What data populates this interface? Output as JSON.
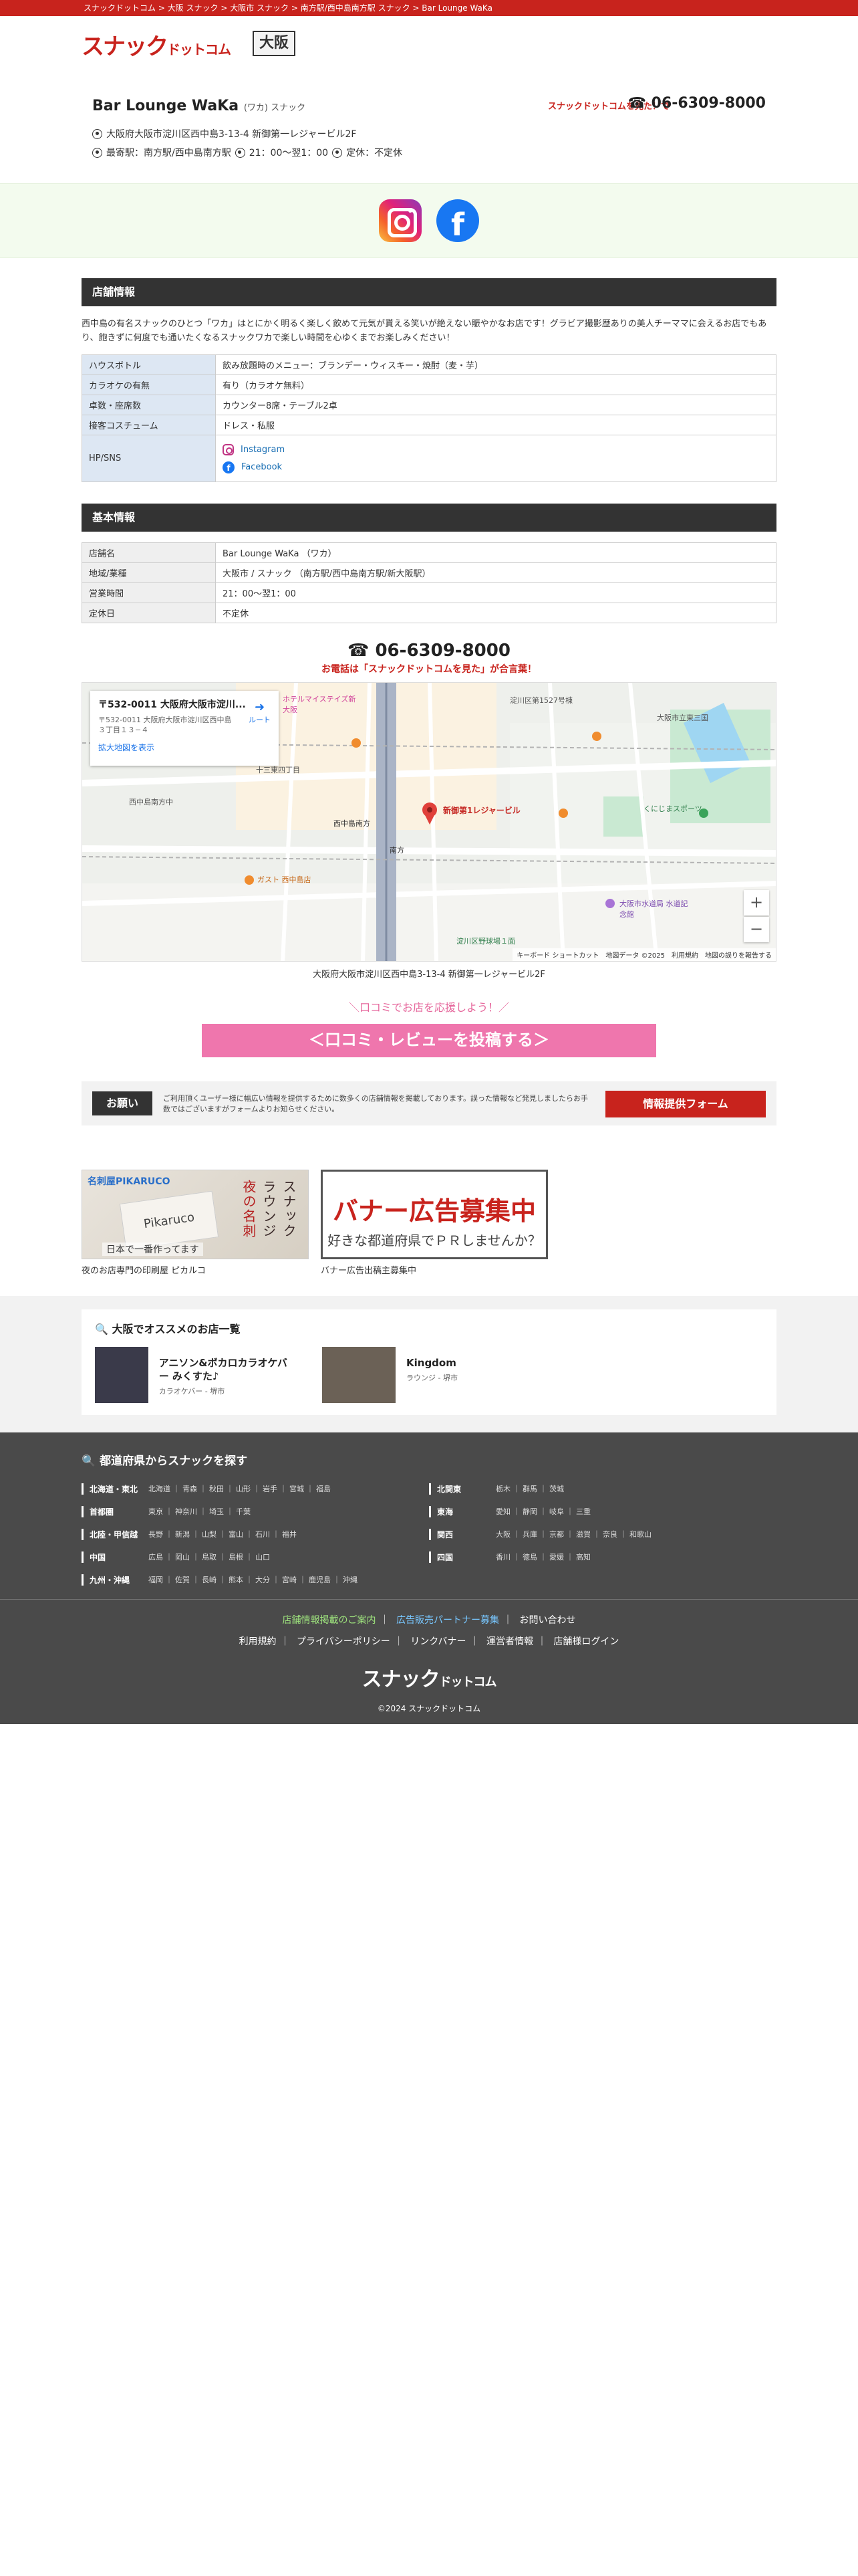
{
  "breadcrumb": [
    "スナックドットコム",
    "大阪 スナック",
    "大阪市 スナック",
    "南方駅/西中島南方駅 スナック",
    "Bar Lounge WaKa"
  ],
  "logo": {
    "main": "スナック",
    "sub": "ドットコム"
  },
  "prefecture": "大阪",
  "shop": {
    "name": "Bar Lounge WaKa",
    "kana": "(ワカ) スナック",
    "see_text": "スナックドットコムを見た！で",
    "tel": "06-6309-8000",
    "address": "大阪府大阪市淀川区西中島3-13-4 新御第一レジャービル2F",
    "station": "最寄駅：南方駅/西中島南方駅",
    "hours": "21：00〜翌1：00",
    "holiday": "定休：不定休"
  },
  "shop_info": {
    "title": "店舗情報",
    "description": "西中島の有名スナックのひとつ「ワカ」はとにかく明るく楽しく飲めて元気が貰える笑いが絶えない賑やかなお店です！グラビア撮影歴ありの美人チーママに会えるお店でもあり、飽きずに何度でも通いたくなるスナックワカで楽しい時間を心ゆくまでお楽しみください！",
    "rows": [
      {
        "k": "ハウスボトル",
        "v": "飲み放題時のメニュー：ブランデー・ウィスキー・焼酎（麦・芋）"
      },
      {
        "k": "カラオケの有無",
        "v": "有り（カラオケ無料）"
      },
      {
        "k": "卓数・座席数",
        "v": "カウンター8席・テーブル2卓"
      },
      {
        "k": "接客コスチューム",
        "v": "ドレス・私服"
      }
    ],
    "sns_key": "HP/SNS",
    "instagram": "Instagram",
    "facebook": "Facebook"
  },
  "basic_info": {
    "title": "基本情報",
    "rows": [
      {
        "k": "店舗名",
        "v": "Bar Lounge WaKa （ワカ）"
      },
      {
        "k": "地域/業種",
        "v": "大阪市 / スナック （南方駅/西中島南方駅/新大阪駅）"
      },
      {
        "k": "営業時間",
        "v": "21：00〜翌1：00"
      },
      {
        "k": "定休日",
        "v": "不定休"
      }
    ]
  },
  "tel_block": {
    "tel": "06-6309-8000",
    "note": "お電話は「スナックドットコムを見た」が合言葉！"
  },
  "map": {
    "card_title": "〒532-0011 大阪府大阪市淀川...",
    "card_sub": "〒532-0011 大阪府大阪市淀川区西中島３丁目１３−４",
    "enlarge": "拡大地図を表示",
    "route": "ルート",
    "pin_label": "新御第1レジャービル",
    "labels": [
      "淀川区第1527号棟",
      "大阪市立東三国",
      "西中島南方",
      "南方",
      "十三東四丁目",
      "西中島南方中",
      "ホテルマイステイズ新大阪",
      "ガスト 西中島店",
      "大阪市水道局 水道記念館",
      "淀川区野球場１面",
      "くにじまスポーツ"
    ],
    "footer": "キーボード ショートカット　地図データ ©2025　利用規約　地図の誤りを報告する",
    "address": "大阪府大阪市淀川区西中島3-13-4 新御第一レジャービル2F"
  },
  "review": {
    "cheer": "＼口コミでお店を応援しよう！／",
    "button": "＜口コミ・レビューを投稿する＞"
  },
  "request": {
    "tag": "お願い",
    "text": "ご利用頂くユーザー様に幅広い情報を提供するために数多くの店舗情報を掲載しております。誤った情報など発見しましたらお手数ではございますがフォームよりお知らせください。",
    "button": "情報提供フォーム"
  },
  "banners": [
    {
      "cap_top": "名刺屋PIKARUCO",
      "card": "Pikaruco",
      "vt1": "スナック",
      "vt2": "ラウンジ",
      "vt3": "夜の名刺",
      "btm": "日本で一番作ってます",
      "caption": "夜のお店専門の印刷屋 ピカルコ"
    },
    {
      "big": "バナー広告募集中",
      "small": "好きな都道府県でＰＲしませんか？",
      "caption": "バナー広告出稿主募集中"
    }
  ],
  "recommend": {
    "title": "大阪でオススメのお店一覧",
    "items": [
      {
        "name": "アニソン&ボカロカラオケバー みくすた♪",
        "cat": "カラオケバー - 堺市"
      },
      {
        "name": "Kingdom",
        "cat": "ラウンジ - 堺市"
      }
    ]
  },
  "footer": {
    "title": "都道府県からスナックを探す",
    "regions": [
      {
        "r": "北海道・東北",
        "p": "北海道 ｜ 青森 ｜ 秋田 ｜ 山形 ｜ 岩手 ｜ 宮城 ｜ 福島"
      },
      {
        "r": "北関東",
        "p": "栃木 ｜ 群馬 ｜ 茨城"
      },
      {
        "r": "首都圏",
        "p": "東京 ｜ 神奈川 ｜ 埼玉 ｜ 千葉"
      },
      {
        "r": "東海",
        "p": "愛知 ｜ 静岡 ｜ 岐阜 ｜ 三重"
      },
      {
        "r": "北陸・甲信越",
        "p": "長野 ｜ 新潟 ｜ 山梨 ｜ 富山 ｜ 石川 ｜ 福井"
      },
      {
        "r": "関西",
        "p": "大阪 ｜ 兵庫 ｜ 京都 ｜ 滋賀 ｜ 奈良 ｜ 和歌山"
      },
      {
        "r": "中国",
        "p": "広島 ｜ 岡山 ｜ 鳥取 ｜ 島根 ｜ 山口"
      },
      {
        "r": "四国",
        "p": "香川 ｜ 徳島 ｜ 愛媛 ｜ 高知"
      },
      {
        "r": "九州・沖縄",
        "p": "福岡 ｜ 佐賀 ｜ 長崎 ｜ 熊本 ｜ 大分 ｜ 宮崎 ｜ 鹿児島 ｜ 沖縄"
      }
    ],
    "link_shop": "店舗情報掲載のご案内",
    "link_partner": "広告販売パートナー募集",
    "link_contact": "お問い合わせ",
    "link_terms": "利用規約",
    "link_privacy": "プライバシーポリシー",
    "link_banner": "リンクバナー",
    "link_company": "運営者情報",
    "link_login": "店舗様ログイン",
    "copyright": "©2024 スナックドットコム"
  }
}
